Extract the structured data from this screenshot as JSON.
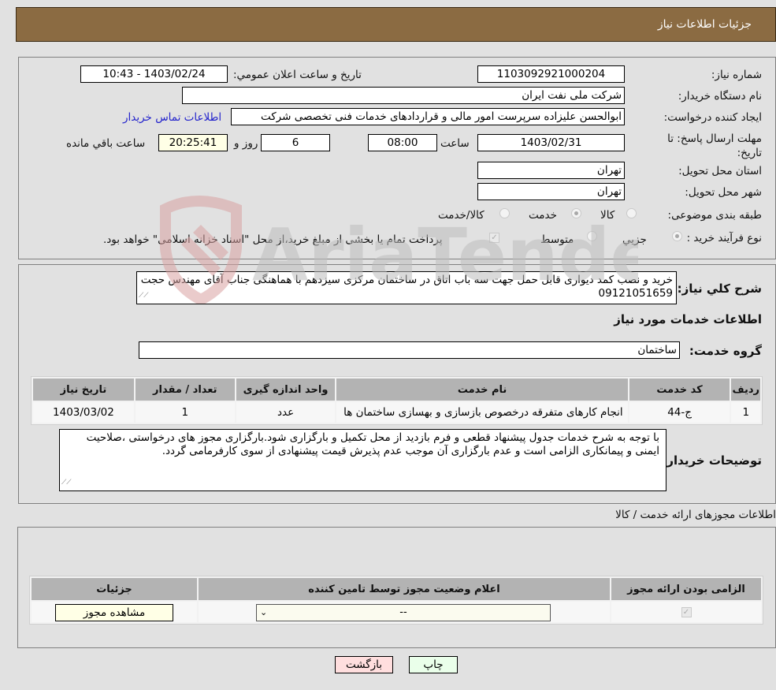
{
  "header": {
    "title": "جزئیات اطلاعات نیاز"
  },
  "details": {
    "need_number_label": "شماره نیاز:",
    "need_number": "1103092921000204",
    "announce_label": "تاريخ و ساعت اعلان عمومي:",
    "announce_value": "1403/02/24 - 10:43",
    "buyer_org_label": "نام دستگاه خريدار:",
    "buyer_org": "شرکت ملی نفت ایران",
    "requester_label": "ایجاد کننده درخواست:",
    "requester": "ابوالحسن علیزاده سرپرست امور مالی و قراردادهای خدمات فنی تخصصی شرکت",
    "contact_link": "اطلاعات تماس خریدار",
    "deadline_label": "مهلت ارسال پاسخ: تا تاريخ:",
    "deadline_date": "1403/02/31",
    "time_label": "ساعت",
    "deadline_time": "08:00",
    "days_value": "6",
    "days_label": "روز و",
    "remaining_time": "20:25:41",
    "remaining_label": "ساعت باقي مانده",
    "province_label": "استان محل تحویل:",
    "province": "تهران",
    "city_label": "شهر محل تحویل:",
    "city": "تهران",
    "category_label": "طبقه بندی موضوعی:",
    "category_options": [
      {
        "label": "کالا",
        "selected": false
      },
      {
        "label": "خدمت",
        "selected": true
      },
      {
        "label": "کالا/خدمت",
        "selected": false
      }
    ],
    "process_label": "نوع فرآیند خرید :",
    "process_options": [
      {
        "label": "جزیي",
        "selected": true
      },
      {
        "label": "متوسط",
        "selected": false
      }
    ],
    "treasury_checked": true,
    "treasury_note": "پرداخت تمام یا بخشی از مبلغ خرید،از محل \"اسناد خزانه اسلامی\" خواهد بود."
  },
  "needs": {
    "summary_label": "شرح كلي نياز:",
    "summary": "خرید و نصب کمد دیواری قابل حمل جهت سه باب اتاق  در ساختمان مرکزی سیزدهم با هماهنگی جناب آقای مهندس حجت 09121051659",
    "services_title": "اطلاعات خدمات مورد نیاز",
    "service_group_label": "گروه خدمت:",
    "service_group": "ساختمان",
    "table": {
      "headers": [
        "ردیف",
        "کد خدمت",
        "نام خدمت",
        "واحد اندازه گیری",
        "تعداد / مقدار",
        "تاریخ نیاز"
      ],
      "rows": [
        [
          "1",
          "ج-44",
          "انجام کارهای متفرقه درخصوص بازسازی و بهسازی ساختمان ها",
          "عدد",
          "1",
          "1403/03/02"
        ]
      ]
    },
    "buyer_notes_label": "توضیحات خریدار:",
    "buyer_notes": "با توجه به شرح خدمات جدول پیشنهاد قطعی و فرم بازدید از محل تکمیل و بارگزاری شود.بارگزاری مجوز های درخواستی ،صلاحیت ایمنی و پیمانکاری الزامی است و عدم بارگزاری آن موجب عدم پذیرش قیمت پیشنهادی  از سوی کارفرمامی گردد."
  },
  "permits": {
    "section_title": "اطلاعات مجوزهای ارائه خدمت / کالا",
    "headers": [
      "الزامی بودن ارائه مجوز",
      "اعلام وضعیت مجوز توسط تامین کننده",
      "جزئیات"
    ],
    "row": {
      "required_checked": true,
      "status_selected": "--",
      "view_button": "مشاهده مجوز"
    }
  },
  "actions": {
    "print": "چاپ",
    "back": "بازگشت"
  },
  "watermark": {
    "text": "AriaTender.neT"
  },
  "colors": {
    "header_bg": "#8b6b42",
    "page_bg": "#e1e1e1",
    "link": "#2222cc",
    "print_btn_bg": "#eaffea",
    "back_btn_bg": "#ffdede",
    "view_btn_bg": "#ffffe6"
  }
}
